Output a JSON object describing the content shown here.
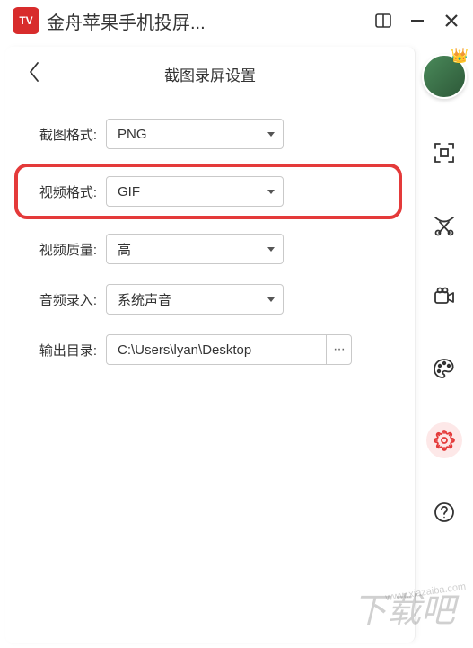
{
  "titlebar": {
    "title": "金舟苹果手机投屏..."
  },
  "settings": {
    "title": "截图录屏设置",
    "labels": {
      "screenshot_format": "截图格式:",
      "video_format": "视频格式:",
      "video_quality": "视频质量:",
      "audio_input": "音频录入:",
      "output_dir": "输出目录:"
    },
    "values": {
      "screenshot_format": "PNG",
      "video_format": "GIF",
      "video_quality": "高",
      "audio_input": "系统声音",
      "output_dir": "C:\\Users\\lyan\\Desktop"
    }
  },
  "path_button": "···",
  "watermark": {
    "main": "下载吧",
    "sub": "www.xiazaiba.com"
  }
}
